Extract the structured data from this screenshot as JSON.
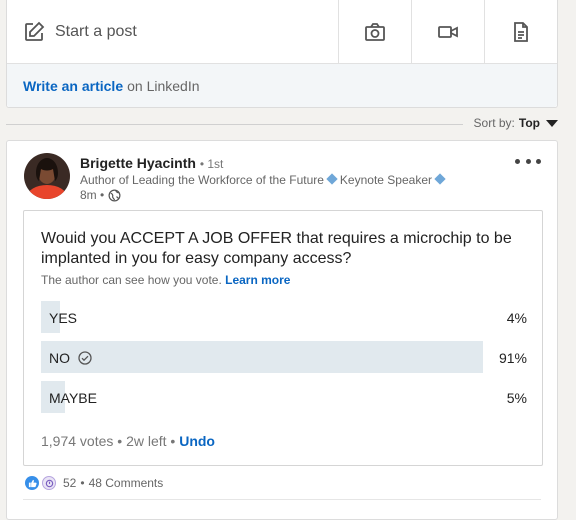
{
  "share": {
    "start_post_label": "Start a post",
    "article_link_label": "Write an article",
    "article_suffix": "on LinkedIn",
    "icons": [
      "pencil-square-icon",
      "camera-icon",
      "video-icon",
      "document-icon"
    ]
  },
  "sort": {
    "label": "Sort by:",
    "value": "Top"
  },
  "post": {
    "author": "Brigette Hyacinth",
    "degree": "• 1st",
    "headline_part1": "Author of Leading the Workforce of the Future",
    "headline_part2": "Keynote Speaker",
    "time": "8m •",
    "poll": {
      "question": "Wouid you ACCEPT A JOB OFFER that requires a microchip to be implanted in you for easy company access?",
      "note": "The author can see how you vote.",
      "learn_more": "Learn more",
      "options": [
        {
          "label": "YES",
          "percent_text": "4%",
          "percent": 4,
          "selected": false
        },
        {
          "label": "NO",
          "percent_text": "91%",
          "percent": 91,
          "selected": true
        },
        {
          "label": "MAYBE",
          "percent_text": "5%",
          "percent": 5,
          "selected": false
        }
      ],
      "footer_text": "1,974 votes • 2w left •",
      "undo_label": "Undo"
    },
    "social": {
      "reactions": "52",
      "separator": "•",
      "comments": "48 Comments"
    }
  },
  "colors": {
    "link": "#0a66c2",
    "poll_fill": "#e1e9ee",
    "page_bg": "#f3f2ef"
  }
}
